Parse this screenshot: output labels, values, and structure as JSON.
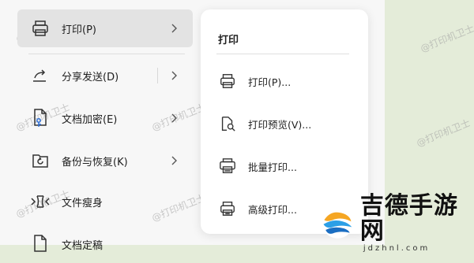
{
  "menu": {
    "items": [
      {
        "label": "打印(P)",
        "icon": "printer-icon",
        "submenu": true,
        "active": true
      },
      {
        "label": "分享发送(D)",
        "icon": "share-icon",
        "submenu": true,
        "split": true
      },
      {
        "label": "文档加密(E)",
        "icon": "document-lock-icon",
        "submenu": true
      },
      {
        "label": "备份与恢复(K)",
        "icon": "backup-icon",
        "submenu": true
      },
      {
        "label": "文件瘦身",
        "icon": "compress-icon",
        "submenu": false
      },
      {
        "label": "文档定稿",
        "icon": "document-icon",
        "submenu": false
      }
    ]
  },
  "submenu": {
    "title": "打印",
    "items": [
      {
        "label": "打印(P)...",
        "icon": "printer-icon"
      },
      {
        "label": "打印预览(V)...",
        "icon": "print-preview-icon"
      },
      {
        "label": "批量打印...",
        "icon": "batch-print-icon"
      },
      {
        "label": "高级打印...",
        "icon": "advanced-print-icon"
      }
    ]
  },
  "watermark": "@打印机卫士",
  "brand": {
    "name": "吉德手游网",
    "url": "jdzhnl.com"
  }
}
